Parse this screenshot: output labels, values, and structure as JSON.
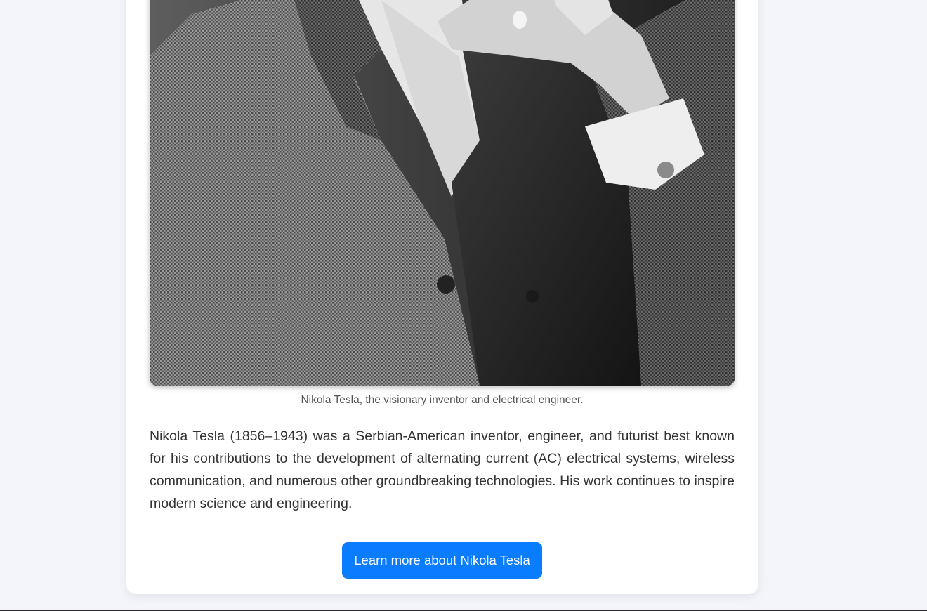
{
  "figure": {
    "image_subject": "Nikola Tesla portrait photograph (black and white)",
    "caption": "Nikola Tesla, the visionary inventor and electrical engineer."
  },
  "bio": {
    "text": "Nikola Tesla (1856–1943) was a Serbian-American inventor, engineer, and futurist best known for his contributions to the development of alternating current (AC) electrical systems, wireless communication, and numerous other groundbreaking technologies. His work continues to inspire modern science and engineering."
  },
  "cta": {
    "label": "Learn more about Nikola Tesla",
    "color": "#0a7cff"
  },
  "colors": {
    "page_background": "#f4f5fa",
    "card_background": "#ffffff"
  }
}
